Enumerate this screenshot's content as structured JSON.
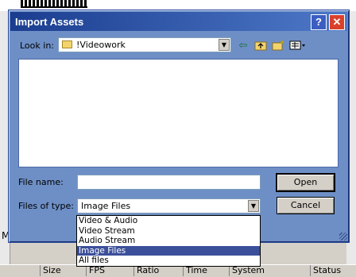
{
  "background": {
    "left_fragment": "M",
    "columns": [
      "Size",
      "FPS",
      "Ratio",
      "Time",
      "System",
      "Status"
    ]
  },
  "dialog": {
    "title": "Import Assets",
    "help_label": "?",
    "close_label": "✕"
  },
  "look_in": {
    "label": "Look in:",
    "value": "!Videowork"
  },
  "toolbar": {
    "back_icon": "back-arrow-icon",
    "up_icon": "up-folder-icon",
    "new_folder_icon": "new-folder-icon",
    "view_icon": "view-menu-icon"
  },
  "file_name": {
    "label": "File name:",
    "value": ""
  },
  "files_of_type": {
    "label": "Files of type:",
    "value": "Image Files",
    "options": [
      "Video & Audio",
      "Video Stream",
      "Audio Stream",
      "Image Files",
      "All files"
    ],
    "selected_index": 3
  },
  "buttons": {
    "open": "Open",
    "cancel": "Cancel"
  },
  "colors": {
    "dialog_body": "#6e8fc6",
    "title_bar": "#1b3d8f",
    "selection": "#3b4f9a"
  }
}
